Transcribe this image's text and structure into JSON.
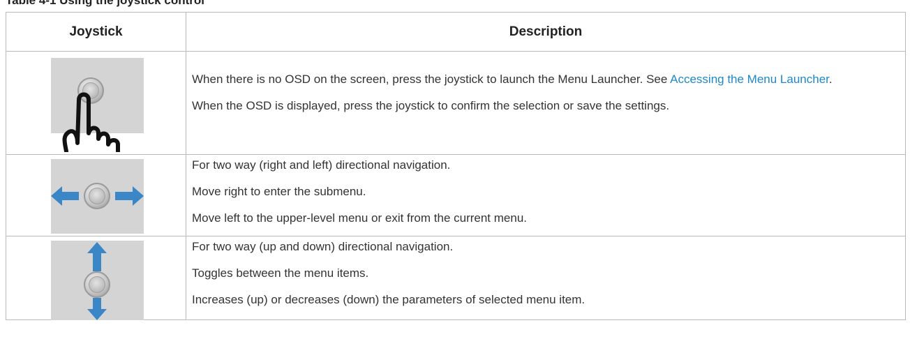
{
  "caption": "Table 4-1 Using the joystick control",
  "table": {
    "headers": [
      "Joystick",
      "Description"
    ],
    "rows": [
      {
        "icon": "joystick-press-icon",
        "paragraphs": [
          "When there is no OSD on the screen, press the joystick to launch the Menu Launcher. See ",
          "When the OSD is displayed, press the joystick to confirm the selection or save the settings."
        ],
        "link_text": "Accessing the Menu Launcher",
        "link_suffix": "."
      },
      {
        "icon": "joystick-left-right-icon",
        "paragraphs": [
          "For two way (right and left) directional navigation.",
          "Move right to enter the submenu.",
          "Move left to the upper-level menu or exit from the current menu."
        ]
      },
      {
        "icon": "joystick-up-down-icon",
        "paragraphs": [
          "For two way (up and down) directional navigation.",
          "Toggles between the menu items.",
          "Increases (up) or decreases (down) the parameters of selected menu item."
        ]
      }
    ]
  },
  "colors": {
    "link": "#1e88c8",
    "arrow": "#3a86c6",
    "icon_bg": "#d4d4d4",
    "border": "#b9b9b9"
  }
}
